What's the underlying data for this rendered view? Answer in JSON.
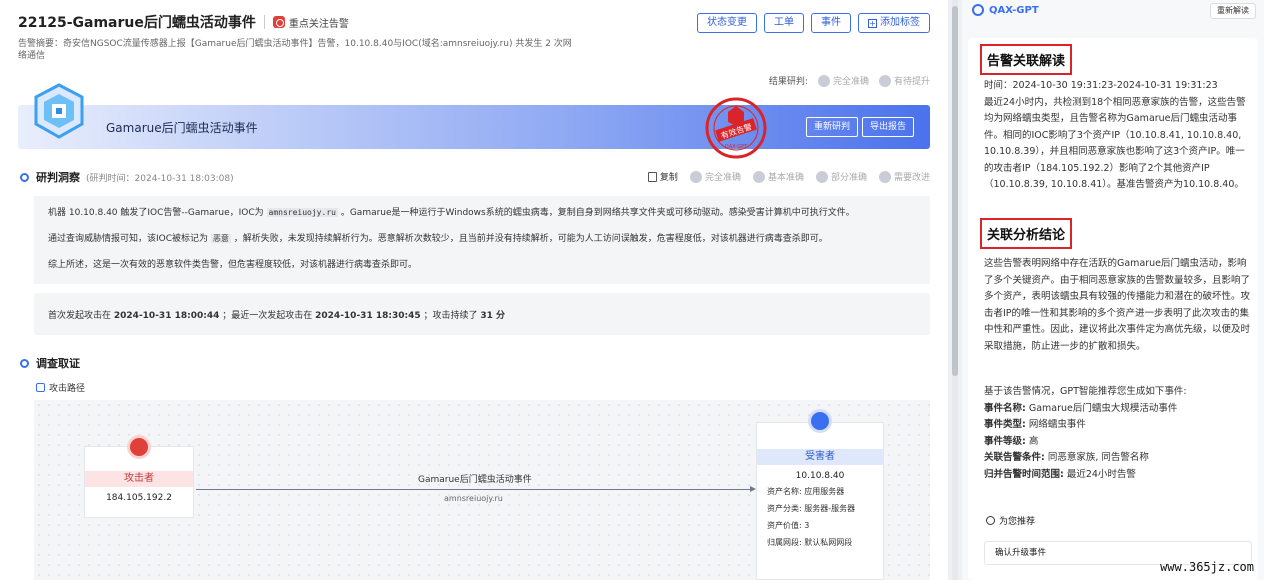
{
  "header": {
    "title": "22125-Gamarue后门蠕虫活动事件",
    "focus_label": "重点关注告警",
    "summary": "告警摘要：奇安信NGSOC流量传感器上报【Gamarue后门蠕虫活动事件】告警，10.10.8.40与IOC(域名:amnsreiuojy.ru) 共发生 2 次网络通信",
    "buttons": [
      "状态变更",
      "工单",
      "事件",
      "添加标签"
    ]
  },
  "result_judge": {
    "label": "结果研判:",
    "options": [
      "完全准确",
      "有待提升"
    ]
  },
  "banner": {
    "title": "Gamarue后门蠕虫活动事件",
    "buttons": [
      "重新研判",
      "导出报告"
    ],
    "stamp_text": "有效告警",
    "stamp_sub": "QAX-GPT"
  },
  "insight": {
    "title": "研判洞察",
    "time": "(研判时间：2024-10-31 18:03:08)",
    "copy": "复制",
    "ratings": [
      "完全准确",
      "基本准确",
      "部分准确",
      "需要改进"
    ],
    "p1_a": "机器 10.10.8.40 触发了IOC告警--Gamarue，IOC为",
    "p1_code": "amnsreiuojy.ru",
    "p1_b": "。Gamarue是一种运行于Windows系统的蠕虫病毒，复制自身到网络共享文件夹或可移动驱动。感染受害计算机中可执行文件。",
    "p2_a": "通过查询威胁情报可知，该IOC被标记为",
    "p2_code": "恶意",
    "p2_b": "，解析失败，未发现持续解析行为。恶意解析次数较少，且当前并没有持续解析，可能为人工访问误触发，危害程度低，对该机器进行病毒查杀即可。",
    "p3": "综上所述，这是一次有效的恶意软件类告警，但危害程度较低，对该机器进行病毒查杀即可。",
    "attack_a": "首次发起攻击在",
    "attack_t1": "2024-10-31 18:00:44",
    "attack_b": "；最近一次发起攻击在",
    "attack_t2": "2024-10-31 18:30:45",
    "attack_c": "；攻击持续了",
    "attack_dur": "31 分"
  },
  "evidence": {
    "title": "调查取证",
    "path_title": "攻击路径",
    "attacker_label": "攻击者",
    "attacker_ip": "184.105.192.2",
    "edge_label": "Gamarue后门蠕虫活动事件",
    "edge_sub": "amnsreiuojy.ru",
    "victim_label": "受害者",
    "victim_ip": "10.10.8.40",
    "victim_kv": [
      "资产名称:  应用服务器",
      "资产分类:  服务器-服务器",
      "资产价值:  3",
      "归属网段:  默认私网网段"
    ]
  },
  "gpt": {
    "brand": "QAX-GPT",
    "regen": "重新解读",
    "h1": "告警关联解读",
    "p1": "时间：2024-10-30 19:31:23-2024-10-31 19:31:23\n最近24小时内，共检测到18个相同恶意家族的告警，这些告警均为网络蠕虫类型，且告警名称为Gamarue后门蠕虫活动事件。相同的IOC影响了3个资产IP（10.10.8.41, 10.10.8.40, 10.10.8.39），并且相同恶意家族也影响了这3个资产IP。唯一的攻击者IP（184.105.192.2）影响了2个其他资产IP（10.10.8.39, 10.10.8.41）。基准告警资产为10.10.8.40。",
    "h2": "关联分析结论",
    "p2": "这些告警表明网络中存在活跃的Gamarue后门蠕虫活动，影响了多个关键资产。由于相同恶意家族的告警数量较多，且影响了多个资产，表明该蠕虫具有较强的传播能力和潜在的破坏性。攻击者IP的唯一性和其影响的多个资产进一步表明了此次攻击的集中性和严重性。因此，建议将此次事件定为高优先级，以便及时采取措施，防止进一步的扩散和损失。",
    "rec_intro": "基于该告警情况，GPT智能推荐您生成如下事件:",
    "fields": [
      {
        "k": "事件名称:",
        "v": "Gamarue后门蠕虫大规模活动事件"
      },
      {
        "k": "事件类型:",
        "v": "网络蠕虫事件"
      },
      {
        "k": "事件等级:",
        "v": "高"
      },
      {
        "k": "关联告警条件:",
        "v": "同恶意家族, 同告警名称"
      },
      {
        "k": "归并告警时间范围:",
        "v": "最近24小时告警"
      }
    ],
    "rec_title": "为您推荐",
    "rec_item": "确认升级事件"
  },
  "watermark": "www.365jz.com"
}
